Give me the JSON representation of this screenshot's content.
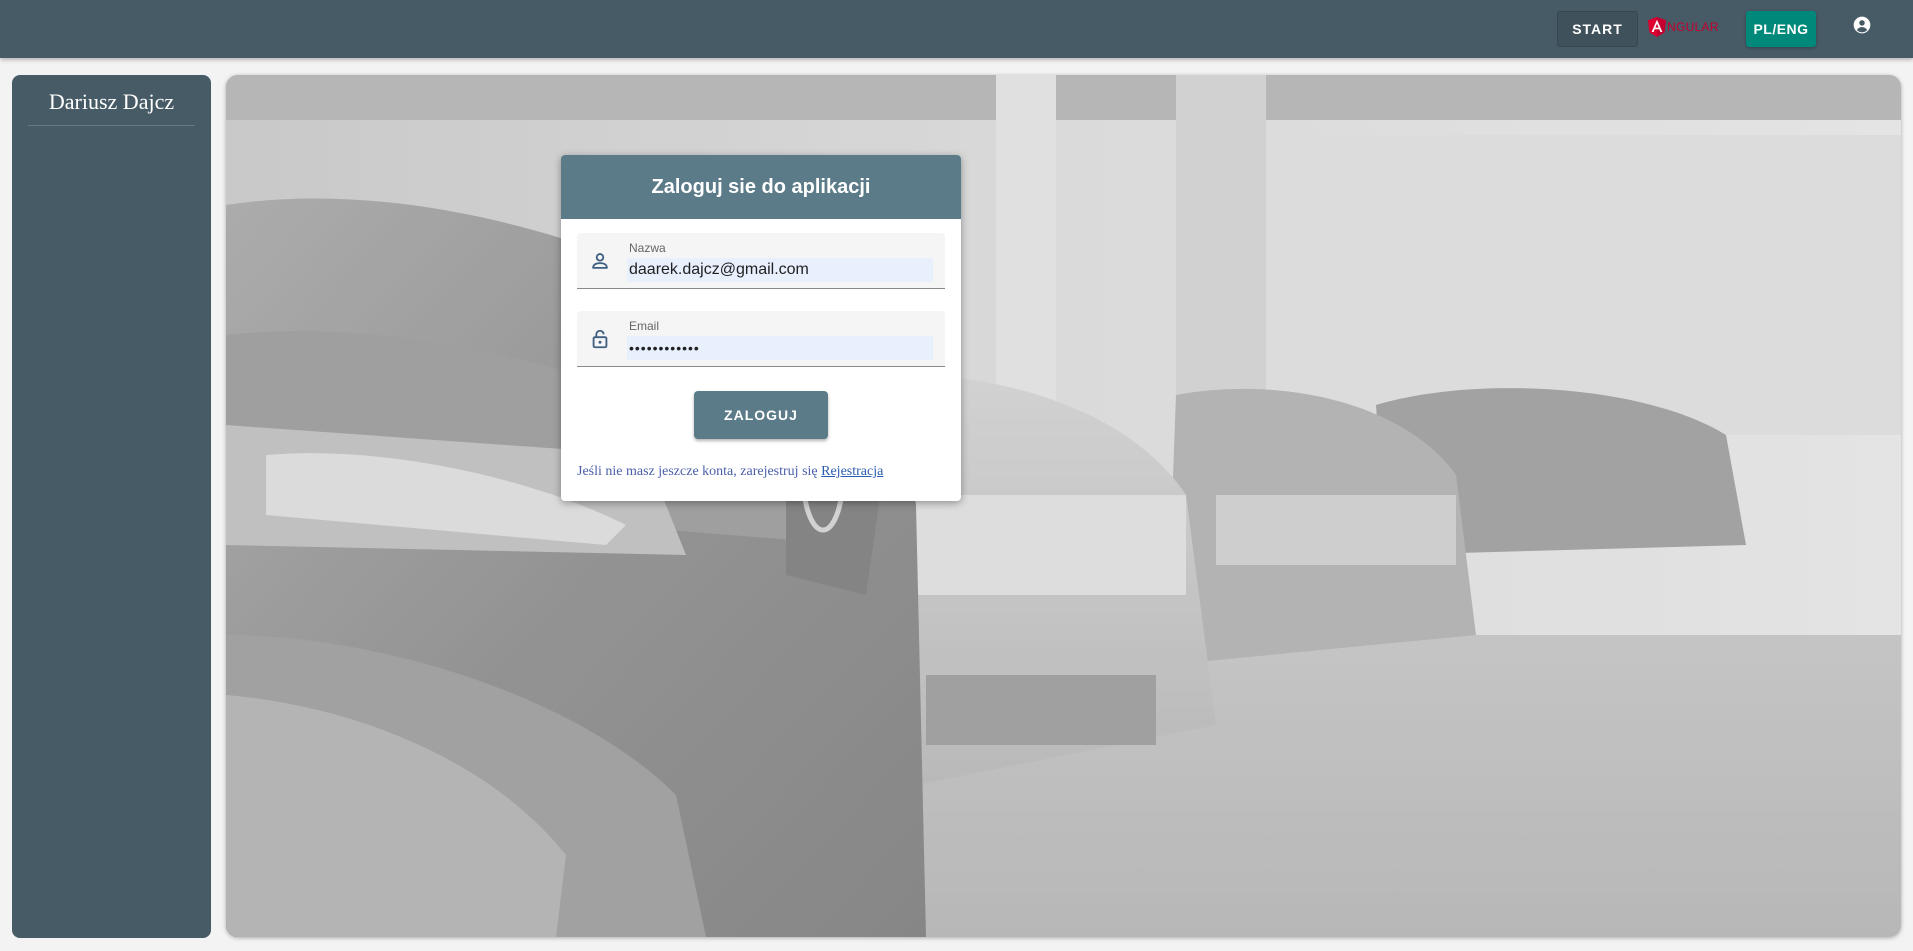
{
  "topbar": {
    "start_label": "START",
    "angular_text": "NGULAR",
    "lang_label": "PL/ENG",
    "account_icon": "account-circle-icon"
  },
  "sidebar": {
    "title": "Dariusz Dajcz"
  },
  "login": {
    "title": "Zaloguj sie do aplikacji",
    "name_label": "Nazwa",
    "name_value": "daarek.dajcz@gmail.com",
    "password_label": "Email",
    "password_value": "••••••••••••",
    "submit_label": "ZALOGUJ",
    "register_text": "Jeśli nie masz jeszcze konta, zarejestruj się",
    "register_link": "Rejestracja"
  },
  "colors": {
    "topbar_bg": "#475b66",
    "sidebar_bg": "#475b66",
    "card_header": "#5b7b89",
    "lang_button": "#00897b",
    "angular_red": "#c3002f"
  }
}
